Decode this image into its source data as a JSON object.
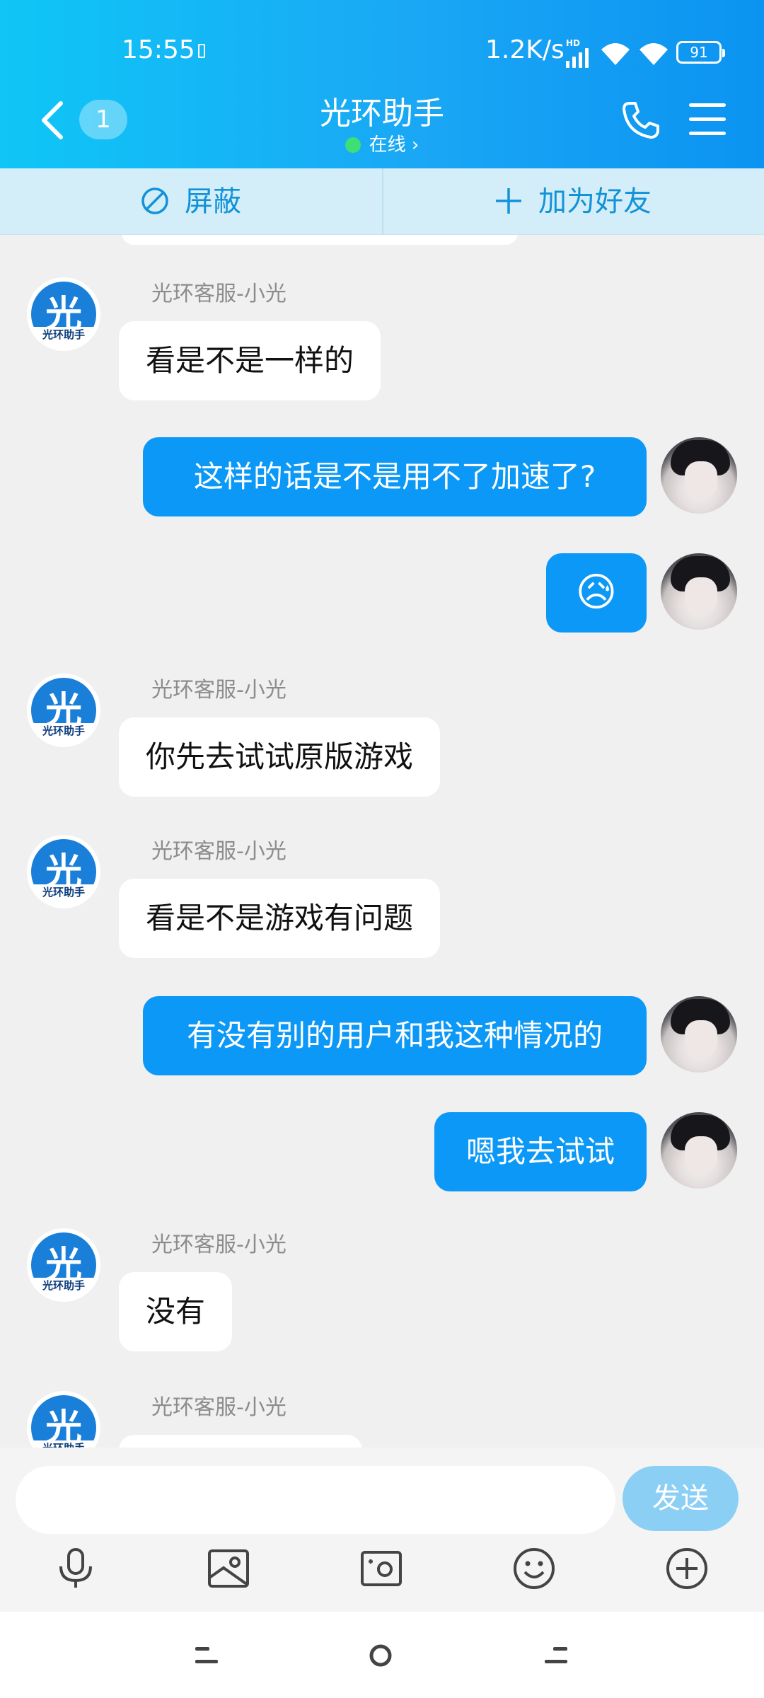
{
  "status_bar": {
    "time": "15:55",
    "network_speed": "1.2K/s",
    "hd_label": "HD",
    "battery": "91"
  },
  "header": {
    "unread_count": "1",
    "title": "光环助手",
    "online_status": "在线 ›",
    "back_icon": "chevron-left-icon",
    "call_icon": "phone-icon",
    "menu_icon": "hamburger-menu-icon"
  },
  "actions": {
    "block_label": "屏蔽",
    "add_friend_label": "加为好友"
  },
  "messages": [
    {
      "side": "in",
      "sender": "光环客服-小光",
      "text": "看是不是一样的"
    },
    {
      "side": "out",
      "text": "这样的话是不是用不了加速了?"
    },
    {
      "side": "out",
      "text": "😥",
      "type": "emoji"
    },
    {
      "side": "in",
      "sender": "光环客服-小光",
      "text": "你先去试试原版游戏"
    },
    {
      "side": "in",
      "sender": "光环客服-小光",
      "text": "看是不是游戏有问题"
    },
    {
      "side": "out",
      "text": "有没有别的用户和我这种情况的"
    },
    {
      "side": "out",
      "text": "嗯我去试试"
    },
    {
      "side": "in",
      "sender": "光环客服-小光",
      "text": "没有"
    },
    {
      "side": "in",
      "sender": "光环客服-小光",
      "text": ""
    }
  ],
  "agent_avatar": {
    "big": "光",
    "small": "光环助手"
  },
  "composer": {
    "placeholder": "",
    "send_label": "发送",
    "tools": [
      "microphone-icon",
      "picture-icon",
      "camera-icon",
      "emoji-icon",
      "plus-icon"
    ]
  },
  "colors": {
    "header_gradient_start": "#0fc6f6",
    "header_gradient_end": "#0b93f1",
    "bubble_out": "#0c98f6",
    "action_text": "#1292d8"
  }
}
